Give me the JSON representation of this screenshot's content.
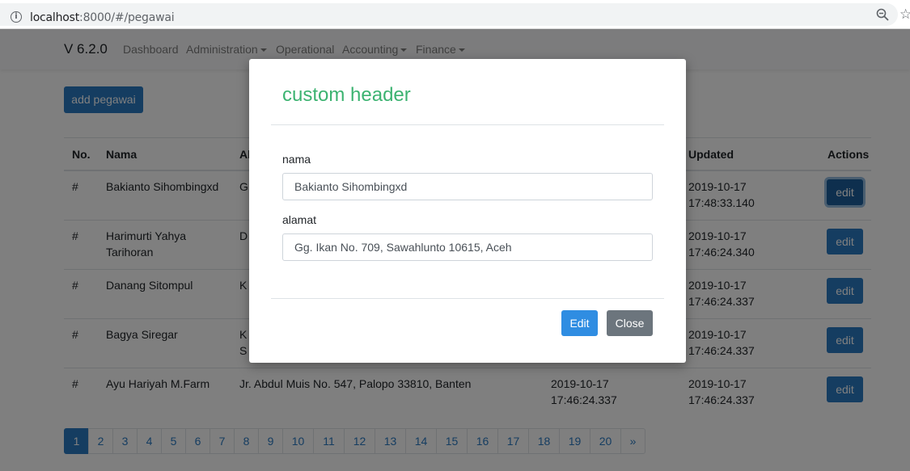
{
  "browser": {
    "url_host": "localhost",
    "url_path": ":8000/#/pegawai"
  },
  "navbar": {
    "brand": "V 6.2.0",
    "items": [
      {
        "label": "Dashboard",
        "dropdown": false
      },
      {
        "label": "Administration",
        "dropdown": true
      },
      {
        "label": "Operational",
        "dropdown": false
      },
      {
        "label": "Accounting",
        "dropdown": true
      },
      {
        "label": "Finance",
        "dropdown": true
      }
    ]
  },
  "add_button": "add pegawai",
  "table": {
    "headers": {
      "no": "No.",
      "nama": "Nama",
      "alamat": "Al",
      "updated": "Updated",
      "actions": "Actions"
    },
    "rows": [
      {
        "no": "#",
        "nama": "Bakianto Sihombingxd",
        "alamat": "G",
        "created": "",
        "updated": "2019-10-17\n17:48:33.140",
        "action": "edit"
      },
      {
        "no": "#",
        "nama": "Harimurti Yahya\nTarihoran",
        "alamat": "D",
        "created": "",
        "updated": "2019-10-17\n17:46:24.340",
        "action": "edit"
      },
      {
        "no": "#",
        "nama": "Danang Sitompul",
        "alamat": "K",
        "created": "",
        "updated": "2019-10-17\n17:46:24.337",
        "action": "edit"
      },
      {
        "no": "#",
        "nama": "Bagya Siregar",
        "alamat": "K\nS",
        "created": "",
        "updated": "2019-10-17\n17:46:24.337",
        "action": "edit"
      },
      {
        "no": "#",
        "nama": "Ayu Hariyah M.Farm",
        "alamat": "Jr. Abdul Muis No. 547, Palopo 33810, Banten",
        "created": "2019-10-17\n17:46:24.337",
        "updated": "2019-10-17\n17:46:24.337",
        "action": "edit"
      }
    ]
  },
  "pagination": {
    "pages": [
      "1",
      "2",
      "3",
      "4",
      "5",
      "6",
      "7",
      "8",
      "9",
      "10",
      "11",
      "12",
      "13",
      "14",
      "15",
      "16",
      "17",
      "18",
      "19",
      "20"
    ],
    "active": "1",
    "next": "»"
  },
  "modal": {
    "title": "custom header",
    "nama_label": "nama",
    "nama_value": "Bakianto Sihombingxd",
    "alamat_label": "alamat",
    "alamat_value": "Gg. Ikan No. 709, Sawahlunto 10615, Aceh",
    "edit_label": "Edit",
    "close_label": "Close"
  },
  "colors": {
    "primary": "#2a7ac3",
    "modal_title": "#3cb371",
    "close_button": "#6c757d"
  },
  "icons": [
    "info-icon",
    "zoom-icon",
    "star-icon",
    "caret-down-icon"
  ]
}
